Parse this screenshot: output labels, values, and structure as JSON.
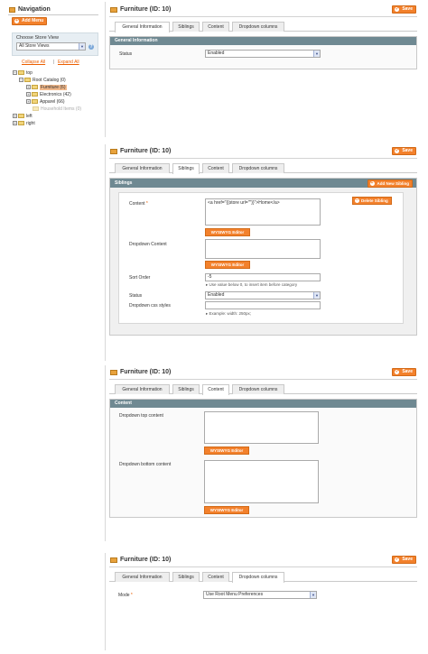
{
  "sidebar": {
    "title": "Navigation",
    "add_menu": "Add Menu",
    "store_view_label": "Choose Store View",
    "store_view_value": "All Store Views",
    "collapse_all": "Collapse All",
    "separator": "|",
    "expand_all": "Expand All",
    "tree": [
      {
        "label": "top"
      },
      {
        "label": "Root Catalog (0)"
      },
      {
        "label": "Furniture (6)"
      },
      {
        "label": "Electronics (42)"
      },
      {
        "label": "Apparel (66)"
      },
      {
        "label": "Household Items (0)"
      },
      {
        "label": "left"
      },
      {
        "label": "right"
      }
    ]
  },
  "panels": {
    "title": "Furniture (ID: 10)",
    "save": "Save",
    "tabs": [
      "General Information",
      "Siblings",
      "Content",
      "Dropdown columns"
    ]
  },
  "general": {
    "section_title": "General Information",
    "status_label": "Status",
    "status_value": "Enabled"
  },
  "siblings": {
    "section_title": "Siblings",
    "add_button": "Add New Sibling",
    "delete_button": "Delete Sibling",
    "content_label": "Content",
    "required_mark": "*",
    "content_value": "<a href=\"{{store url=\"\"}}\">Home</a>",
    "wysiwyg": "WYSIWYG Editor",
    "dropdown_content_label": "Dropdown Content",
    "sort_order_label": "Sort Order",
    "sort_order_value": "-5",
    "sort_order_note": "Use value below 0, to insert item before category",
    "status_label": "Status",
    "status_value": "Enabled",
    "css_label": "Dropdown css styles",
    "css_note": "Example: width: 250px;"
  },
  "content": {
    "section_title": "Content",
    "top_label": "Dropdown top content",
    "bottom_label": "Dropdown bottom content",
    "wysiwyg": "WYSIWYG Editor"
  },
  "columns": {
    "mode_label": "Mode",
    "required_mark": "*",
    "mode_value": "Use Root Menu Preferences"
  },
  "colors": {
    "accent": "#f3812c",
    "section_header": "#6f8992",
    "link": "#eb5e00"
  }
}
